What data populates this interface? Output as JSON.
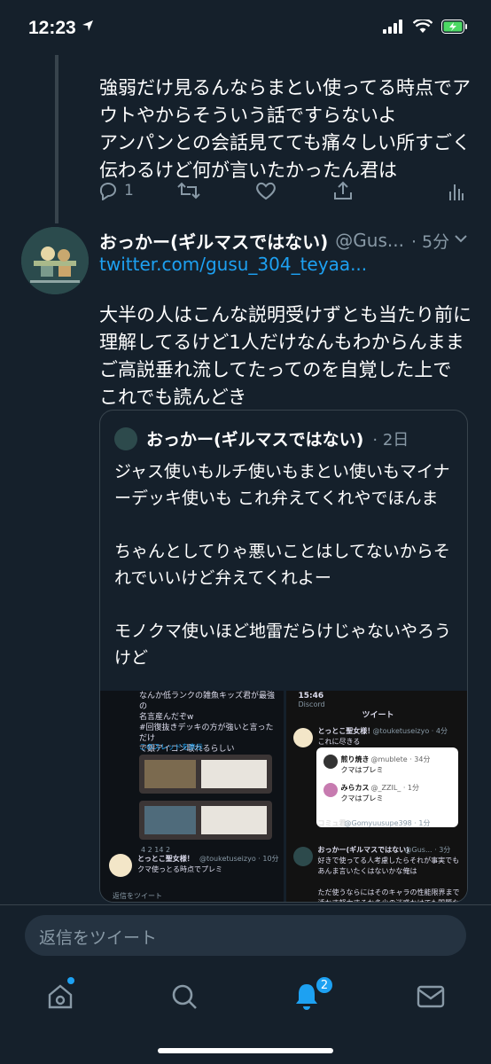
{
  "status": {
    "time": "12:23"
  },
  "tweet1": {
    "text": "強弱だけ見るんならまとい使ってる時点でアウトやからそういう話ですらないよ\nアンパンとの会話見てても痛々しい所すごく伝わるけど何が言いたかったん君は",
    "reply_count": "1"
  },
  "tweet2": {
    "name": "おっかー(ギルマスではない)",
    "handle": "@Gus...",
    "time": "· 5分",
    "link": "twitter.com/gusu_304_teyaa...",
    "text": "大半の人はこんな説明受けずとも当たり前に理解してるけど1人だけなんもわからんままご高説垂れ流してたってのを自覚した上で これでも読んどき"
  },
  "quote": {
    "name": "おっかー(ギルマスではない)",
    "time": "· 2日",
    "text": "ジャス使いもルチ使いもまとい使いもマイナーデッキ使いも  これ弁えてくれやでほんま\n\nちゃんとしてりゃ悪いことはしてないからそれでいいけど弁えてくれよー\n\nモノクマ使いほど地雷だらけじゃないやろうけど"
  },
  "left_image": {
    "top_text": "なんか低ランクの雑魚キッズ君が最強の\n名言産んだぞw\n#回復抜きデッキの方が強いと言っただけ\nで銀アイコン取れるらしい\n#コンパス",
    "thread_link": "このスレッドを表示",
    "reply_name": "とっとこ聖女様！",
    "reply_handle": "@touketuseizyo · 10分",
    "reply_text": "クマ使っとる時点でプレミ",
    "footer": "返信をツイート",
    "counts": [
      "4",
      "2",
      "14",
      "2"
    ]
  },
  "right_image": {
    "time": "15:46",
    "app": "Discord",
    "title": "ツイート",
    "tweet_name": "とっとこ聖女様！",
    "tweet_handle": "@touketuseizyo · 4分",
    "tweet_text": "これに尽きる",
    "inner1_name": "煎り焼き",
    "inner1_handle": "@mublete · 34分",
    "inner1_text": "クマはプレミ",
    "inner2_name": "みらカス",
    "inner2_handle": "@_ZZIL_ · 1分",
    "inner2_text": "クマはプレミ",
    "inner3_name": "コミュ君",
    "inner3_handle": "@Gomyuusupe398 · 1分",
    "reply_name": "おっかー(ギルマスではない)",
    "reply_handle": "@Gus... · 3分",
    "reply_text": "好きで使ってる人考慮したらそれが事実でも\nあんま言いたくはないかな俺は\n\nただ使うならにはそのキャラの性能限界まで\n活かす努力するか多少の迷惑かけても問題な"
  },
  "reply_placeholder": "返信をツイート",
  "notifications_badge": "2",
  "colors": {
    "bg": "#15202b",
    "accent": "#1da1f2",
    "muted": "#8899a6",
    "border": "#38444d"
  }
}
